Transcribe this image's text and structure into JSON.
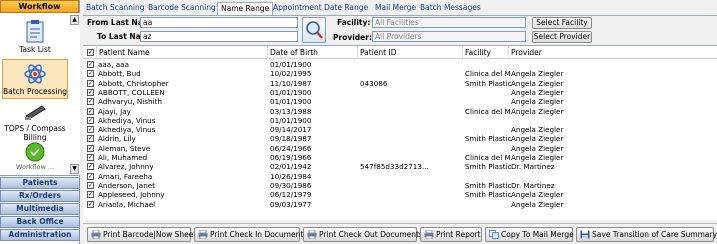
{
  "sidebar": {
    "header": "Workflow",
    "items": [
      {
        "label": "Task List",
        "icon": "clipboard-icon"
      },
      {
        "label": "Batch Processing",
        "icon": "atom-icon"
      },
      {
        "label": "TOPS / Compass Billing",
        "icon": "scanner-icon"
      },
      {
        "label": "",
        "icon": "green-circle-icon"
      },
      {
        "label": "Workflow ...",
        "icon": ""
      }
    ],
    "nav": [
      "Patients",
      "Rx/Orders",
      "Multimedia",
      "Back Office",
      "Administration"
    ]
  },
  "tabs": [
    "Batch Scanning",
    "Barcode Scanning",
    "Name Range",
    "Appointment Date Range",
    "Mail Merge",
    "Batch Messages"
  ],
  "active_tab": "Name Range",
  "filters": {
    "from_label": "From Last Name:",
    "from_value": "aa",
    "to_label": "To Last Name:",
    "to_value": "az",
    "facility_label": "Facility:",
    "facility_value": "All Facilities",
    "provider_label": "Provider:",
    "provider_value": "All Providers",
    "select_facility": "Select Facility",
    "select_provider": "Select Provider"
  },
  "grid": {
    "columns": [
      "Patient Name",
      "Date of Birth",
      "Patient ID",
      "Facility",
      "Provider"
    ],
    "rows": [
      {
        "name": "aaa, aaa",
        "dob": "01/01/1900",
        "pid": "",
        "facility": "",
        "provider": ""
      },
      {
        "name": "Abbott, Bud",
        "dob": "10/02/1995",
        "pid": "",
        "facility": "Clinica del Mar",
        "provider": "Angela Ziegler"
      },
      {
        "name": "Abbott, Christopher",
        "dob": "11/10/1987",
        "pid": "043086",
        "facility": "Smith Plastic Sur...",
        "provider": "Angela Ziegler"
      },
      {
        "name": "ABBOTT, COLLEEN",
        "dob": "01/01/1900",
        "pid": "",
        "facility": "",
        "provider": "Angela Ziegler"
      },
      {
        "name": "Adhvaryu, Nishith",
        "dob": "01/01/1900",
        "pid": "",
        "facility": "",
        "provider": "Angela Ziegler"
      },
      {
        "name": "Ajayi, Jay",
        "dob": "03/13/1988",
        "pid": "",
        "facility": "Clinica del Mar",
        "provider": "Angela Ziegler"
      },
      {
        "name": "Akhediya, Vinus",
        "dob": "01/01/1900",
        "pid": "",
        "facility": "",
        "provider": ""
      },
      {
        "name": "Akhediya, Vinus",
        "dob": "09/14/2017",
        "pid": "",
        "facility": "",
        "provider": "Angela Ziegler"
      },
      {
        "name": "Aldrin, Lily",
        "dob": "09/18/1987",
        "pid": "",
        "facility": "Smith Plastic Sur...",
        "provider": "Angela Ziegler"
      },
      {
        "name": "Aleman, Steve",
        "dob": "06/24/1966",
        "pid": "",
        "facility": "",
        "provider": "Angela Ziegler"
      },
      {
        "name": "Ali, Muhamed",
        "dob": "06/19/1966",
        "pid": "",
        "facility": "Clinica del Mar",
        "provider": "Angela Ziegler"
      },
      {
        "name": "Alvarez, Johnny",
        "dob": "02/01/1942",
        "pid": "547f85d33d2713...",
        "facility": "Smith Plastic Sur...",
        "provider": "Dr. Martinez"
      },
      {
        "name": "Amari, Fareeha",
        "dob": "10/26/1984",
        "pid": "",
        "facility": "",
        "provider": ""
      },
      {
        "name": "Anderson, Janet",
        "dob": "09/30/1986",
        "pid": "",
        "facility": "Smith Plastic Sur...",
        "provider": "Dr. Martinez"
      },
      {
        "name": "Appleseed, Johnny",
        "dob": "06/12/1979",
        "pid": "",
        "facility": "Smith Plastic Sur...",
        "provider": "Angela Ziegler"
      },
      {
        "name": "Ariaola, Michael",
        "dob": "09/03/1977",
        "pid": "",
        "facility": "",
        "provider": "Angela Ziegler"
      }
    ]
  },
  "toolbar": [
    {
      "label": "Print Barcode|Now Sheets",
      "icon": "printer-icon"
    },
    {
      "label": "Print Check In Documents",
      "icon": "printer-icon"
    },
    {
      "label": "Print Check Out Documents",
      "icon": "printer-icon"
    },
    {
      "label": "Print Report",
      "icon": "printer-icon"
    },
    {
      "label": "Copy To Mail Merge",
      "icon": "copy-icon"
    },
    {
      "label": "Save Transition of Care Summary",
      "icon": "save-icon"
    }
  ],
  "colors": {
    "workflow_header": "#f7a21b",
    "nav_text": "#1b3a78",
    "selected_item": "#fde5bd"
  }
}
